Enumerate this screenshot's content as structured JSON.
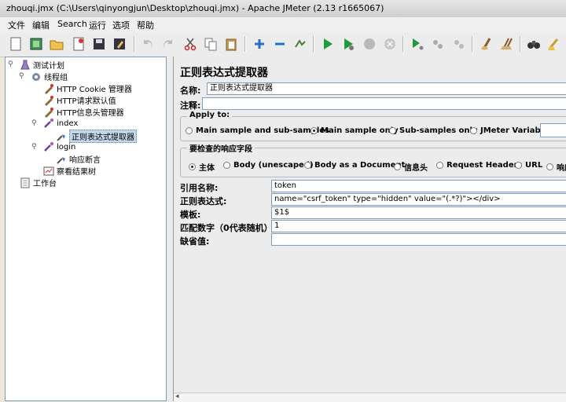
{
  "window": {
    "title": "zhouqi.jmx (C:\\Users\\qinyongjun\\Desktop\\zhouqi.jmx) - Apache JMeter (2.13 r1665067)"
  },
  "menu": [
    "文件",
    "编辑",
    "Search",
    "运行",
    "选项",
    "帮助"
  ],
  "toolbar_icons": [
    "new-icon",
    "templates-icon",
    "open-icon",
    "close-icon",
    "save-icon",
    "save-as-icon",
    "undo-icon",
    "redo-icon",
    "cut-icon",
    "copy-icon",
    "paste-icon",
    "expand-icon",
    "collapse-icon",
    "toggle-icon",
    "start-icon",
    "start-no-pause-icon",
    "stop-icon",
    "shutdown-icon",
    "remote-start-icon",
    "remote-stop-icon",
    "remote-shutdown-icon",
    "clear-icon",
    "clear-all-icon",
    "search-icon",
    "reset-search-icon"
  ],
  "tree": [
    {
      "label": "测试计划",
      "icon": "flask-icon"
    },
    {
      "label": "线程组",
      "icon": "gear-icon"
    },
    {
      "label": "HTTP Cookie 管理器",
      "icon": "config-icon"
    },
    {
      "label": "HTTP请求默认值",
      "icon": "config-icon"
    },
    {
      "label": "HTTP信息头管理器",
      "icon": "config-icon"
    },
    {
      "label": "index",
      "icon": "pipette-icon"
    },
    {
      "label": "正则表达式提取器",
      "icon": "extractor-icon"
    },
    {
      "label": "login",
      "icon": "pipette-icon"
    },
    {
      "label": "响应断言",
      "icon": "extractor-icon"
    },
    {
      "label": "察看结果树",
      "icon": "listener-icon"
    },
    {
      "label": "工作台",
      "icon": "workbench-icon"
    }
  ],
  "editor": {
    "title": "正则表达式提取器",
    "name_label": "名称:",
    "name_value": "正则表达式提取器",
    "comment_label": "注释:",
    "apply_to": {
      "legend": "Apply to:",
      "options": [
        "Main sample and sub-samples",
        "Main sample only",
        "Sub-samples only",
        "JMeter Variable"
      ],
      "selected": "Main sample only"
    },
    "check_field": {
      "legend": "要检查的响应字段",
      "options": [
        "主体",
        "Body (unescaped)",
        "Body as a Document",
        "信息头",
        "Request Headers",
        "URL",
        "响应"
      ],
      "selected": "主体"
    },
    "ref_label": "引用名称:",
    "ref_value": "token",
    "regex_label": "正则表达式:",
    "regex_value": "name=\"csrf_token\" type=\"hidden\" value=\"(.*?)\"></div>",
    "template_label": "模板:",
    "template_value": "$1$",
    "match_label": "匹配数字（0代表随机）:",
    "match_value": "1",
    "default_label": "缺省值:",
    "default_value": ""
  },
  "colors": {
    "selection": "#c3d7ea",
    "field_border": "#7f9db9",
    "panel": "#ececec"
  }
}
